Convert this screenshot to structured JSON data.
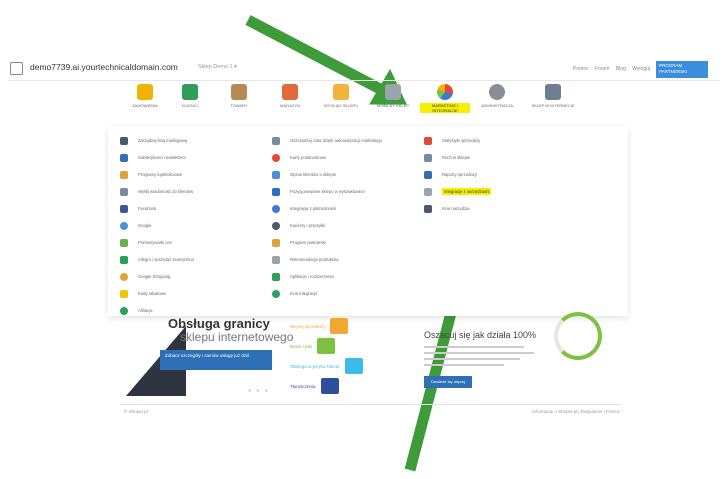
{
  "topbar": {
    "url": "demo7739.ai.yourtechnicaldomain.com",
    "store_select": "Sklep Demo 1 ▾",
    "links": [
      "Pomoc",
      "Forum",
      "Blog",
      "Wyloguj"
    ],
    "pro_label": "PROGRAM PARTNERSKI"
  },
  "modules": [
    {
      "label": "ZAMÓWIENIA",
      "color": "#f0b400",
      "active": false
    },
    {
      "label": "KLIENCI",
      "color": "#2e9e58",
      "active": false
    },
    {
      "label": "TOWARY",
      "color": "#b58a55",
      "active": false
    },
    {
      "label": "MAGAZYN",
      "color": "#e06a3a",
      "active": false
    },
    {
      "label": "WYGLĄD SKLEPU",
      "color": "#f3b23a",
      "active": false
    },
    {
      "label": "MOBILNY SKLEP",
      "color": "#9aa4ad",
      "active": false
    },
    {
      "label": "MARKETING I INTEGRACJE",
      "color": "#3a7bd5",
      "active": true
    },
    {
      "label": "ADMINISTRACJA",
      "color": "#888f96",
      "active": false
    },
    {
      "label": "SKLEP W INTERNECIE",
      "color": "#6e7f92",
      "active": false
    }
  ],
  "menu": {
    "col1": [
      {
        "text": "Zarządzaj listą mailingową",
        "color": "#4a5a6a"
      },
      {
        "text": "Subskrybenci newslettera",
        "color": "#2f6fb5"
      },
      {
        "text": "Programy lojalnościowe",
        "color": "#e0a23a"
      },
      {
        "text": "Wyślij wiadomość do klientów",
        "color": "#7a8aa0"
      },
      {
        "text": "Facebook",
        "color": "#3b5998"
      },
      {
        "text": "Google",
        "color": "#4a90d9"
      },
      {
        "text": "Porównywarki cen",
        "color": "#6ab04c"
      },
      {
        "text": "Allegro i sprzedaż zewnętrzna",
        "color": "#2e9e58"
      },
      {
        "text": "Google Shopping",
        "color": "#e0a23a"
      },
      {
        "text": "Kody rabatowe",
        "color": "#f0c400"
      },
      {
        "text": "Afiliacja",
        "color": "#2e9e58"
      }
    ],
    "col2": [
      {
        "text": "Oszczędzaj czas dzięki automatyzacji marketingu",
        "color": "#7a8aa0"
      },
      {
        "text": "Karty podarunkowe",
        "color": "#e04a3a"
      },
      {
        "text": "Opinie klientów o sklepie",
        "color": "#4a90d9"
      },
      {
        "text": "Pozycjonowanie sklepu w wyszukiwarce",
        "color": "#2f6fb5"
      },
      {
        "text": "Integracja z płatnościami",
        "color": "#3a7bd5"
      },
      {
        "text": "Kurierzy i przesyłki",
        "color": "#4a5a6a"
      },
      {
        "text": "Program partnerski",
        "color": "#e0a23a"
      },
      {
        "text": "Rekomendacje produktów",
        "color": "#9aa4ad"
      },
      {
        "text": "Aplikacje i rozszerzenia",
        "color": "#2e9e58"
      },
      {
        "text": "Inne integracje",
        "color": "#2e9e58"
      }
    ],
    "col3": [
      {
        "text": "Statystyki sprzedaży",
        "color": "#e04a3a",
        "highlight": false
      },
      {
        "text": "Ruch w sklepie",
        "color": "#7a8aa0",
        "highlight": false
      },
      {
        "text": "Raporty sprzedaży",
        "color": "#2f6fb5",
        "highlight": false
      },
      {
        "text": "Integracje z narzędziami",
        "color": "#9aa4ad",
        "highlight": true
      },
      {
        "text": "Inne narzędzia",
        "color": "#4a5a6a",
        "highlight": false
      }
    ]
  },
  "hero": {
    "title": "Obsługa granicy",
    "subtitle": "sklepu internetowego",
    "cta": "Zobacz szczegóły i zamów usługę już dziś",
    "features": [
      {
        "text": "Więcej sprzedaży",
        "color": "#f0a830"
      },
      {
        "text": "Nowe rynki",
        "color": "#7cc142"
      },
      {
        "text": "Obsługa w języku klienta",
        "color": "#3bbbe8"
      },
      {
        "text": "Tłumaczenia",
        "color": "#2f4f9e"
      }
    ],
    "dots": "● ● ●"
  },
  "card": {
    "title": "Oszacuj się jak działa 100%",
    "button": "Dowiedz się więcej"
  },
  "footer": {
    "left": "© Shoper.pl",
    "right": "Informacje o Shoper.pl | Regulamin | Pomoc"
  },
  "colors": {
    "arrow": "#3f9a3a",
    "highlight": "#f4f000",
    "accent": "#3b8ede"
  }
}
